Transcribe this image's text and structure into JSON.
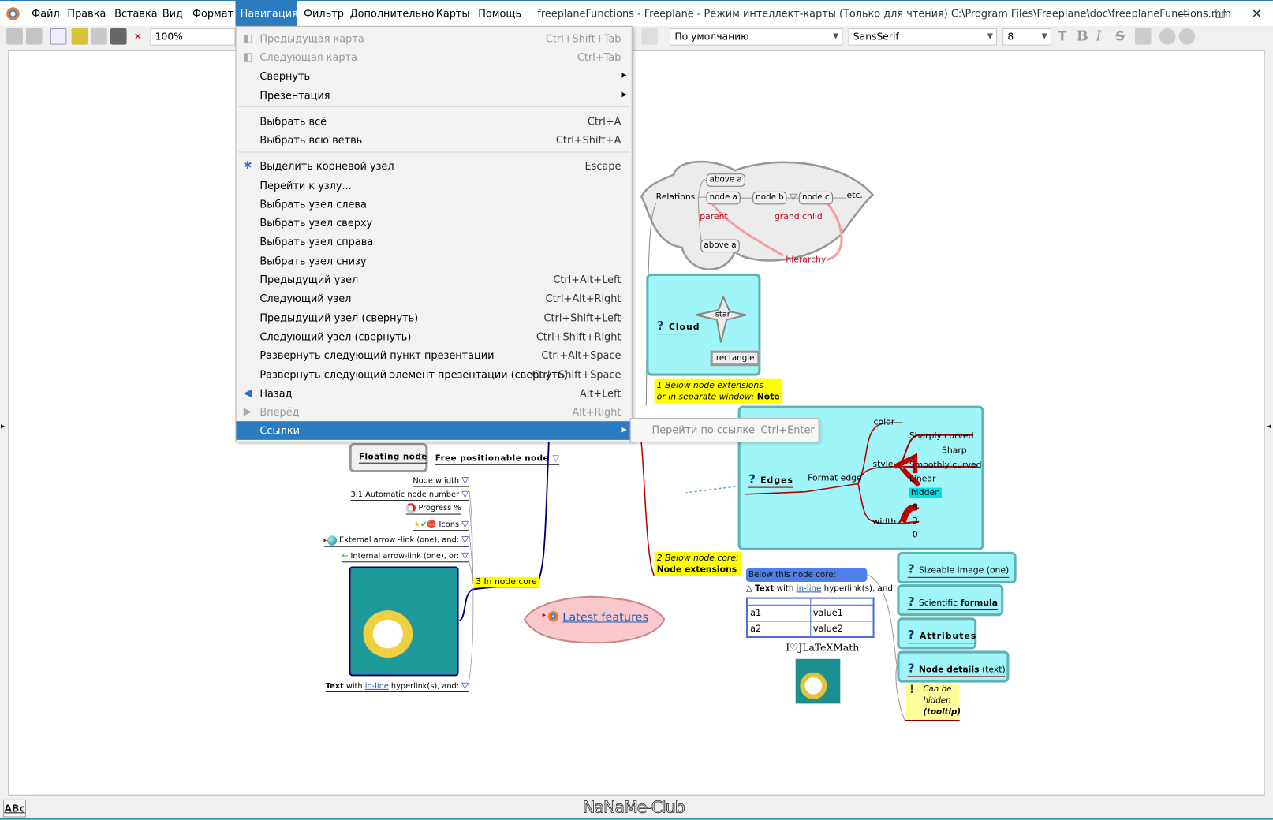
{
  "window": {
    "title": "freeplaneFunctions - Freeplane - Режим интеллект-карты (Только для чтения) C:\\Program Files\\Freeplane\\doc\\freeplaneFunctions.mm",
    "minimize": "—",
    "maximize": "☐",
    "close": "✕"
  },
  "menubar": {
    "items": [
      "Файл",
      "Правка",
      "Вставка",
      "Вид",
      "Формат",
      "Навигация",
      "Фильтр",
      "Дополнительно",
      "Карты",
      "Помощь"
    ],
    "active": "Навигация"
  },
  "toolbar": {
    "zoom": "100%",
    "style": "По умолчанию",
    "font": "SansSerif",
    "size": "8",
    "bold": "B",
    "italic": "I",
    "strike": "S"
  },
  "nav_menu": {
    "items": [
      {
        "label": "Предыдущая карта",
        "shortcut": "Ctrl+Shift+Tab",
        "disabled": true,
        "icon": "prev-map-icon"
      },
      {
        "label": "Следующая карта",
        "shortcut": "Ctrl+Tab",
        "disabled": true,
        "icon": "next-map-icon"
      },
      {
        "label": "Свернуть",
        "shortcut": "",
        "submenu": true
      },
      {
        "label": "Презентация",
        "shortcut": "",
        "submenu": true
      },
      {
        "label": "Выбрать всё",
        "shortcut": "Ctrl+A"
      },
      {
        "label": "Выбрать всю ветвь",
        "shortcut": "Ctrl+Shift+A"
      },
      {
        "label": "Выделить корневой узел",
        "shortcut": "Escape",
        "icon": "root-node-icon"
      },
      {
        "label": "Перейти к узлу...",
        "shortcut": ""
      },
      {
        "label": "Выбрать узел слева",
        "shortcut": ""
      },
      {
        "label": "Выбрать узел сверху",
        "shortcut": ""
      },
      {
        "label": "Выбрать узел справа",
        "shortcut": ""
      },
      {
        "label": "Выбрать узел снизу",
        "shortcut": ""
      },
      {
        "label": "Предыдущий узел",
        "shortcut": "Ctrl+Alt+Left"
      },
      {
        "label": "Следующий узел",
        "shortcut": "Ctrl+Alt+Right"
      },
      {
        "label": "Предыдущий узел (свернуть)",
        "shortcut": "Ctrl+Shift+Left"
      },
      {
        "label": "Следующий узел (свернуть)",
        "shortcut": "Ctrl+Shift+Right"
      },
      {
        "label": "Развернуть следующий пункт презентации",
        "shortcut": "Ctrl+Alt+Space"
      },
      {
        "label": "Развернуть следующий элемент презентации (свернуть)",
        "shortcut": "Ctrl+Shift+Space"
      },
      {
        "label": "Назад",
        "shortcut": "Alt+Left",
        "icon": "back-icon"
      },
      {
        "label": "Вперёд",
        "shortcut": "Alt+Right",
        "disabled": true,
        "icon": "forward-icon"
      },
      {
        "label": "Ссылки",
        "shortcut": "",
        "submenu": true,
        "highlighted": true
      }
    ]
  },
  "submenu": {
    "label": "Перейти по ссылке",
    "shortcut": "Ctrl+Enter"
  },
  "map": {
    "relations": {
      "root": "Relations",
      "above": "above a",
      "node_a": "node a",
      "node_b": "node b",
      "node_c": "node c",
      "etc": "etc.",
      "parent": "parent",
      "grand_child": "grand child",
      "hierarchy": "hierarchy"
    },
    "cloud": {
      "label": "Cloud",
      "star": "star",
      "rectangle": "rectangle"
    },
    "note1": {
      "line1": "1 Below node extensions",
      "line2": "or in separate window: ",
      "bold": "Note"
    },
    "edges": {
      "label": "Edges",
      "format": "Format edge",
      "color": "color",
      "style": "style",
      "width": "width",
      "styles": [
        "Sharply curved",
        "Sharp",
        "Smoothly curved",
        "Linear",
        "hidden"
      ],
      "widths": [
        "8",
        "3",
        "0"
      ]
    },
    "note2": {
      "line1": "2 Below node core:",
      "line2": "Node extensions"
    },
    "details": {
      "header": "Below  this  node core:",
      "text_bold": "Text",
      "text_pre": " with ",
      "link": "in-line",
      "text_post": " hyperlink(s), and:",
      "table": [
        [
          "",
          ""
        ],
        [
          "a1",
          "value1"
        ],
        [
          "a2",
          "value2"
        ]
      ],
      "latex": "I♡JLaTeXMath"
    },
    "right_nodes": [
      {
        "pre": "Sizeable image",
        "post": " (one)"
      },
      {
        "pre": "Scientific ",
        "post": "formula"
      },
      {
        "pre": "Attributes",
        "post": ""
      },
      {
        "pre": "Node details",
        "post": " (text)"
      }
    ],
    "tooltip": {
      "l1": "Can be",
      "l2": "hidden",
      "l3": "(tooltip)"
    },
    "root_node": "Latest features",
    "left": {
      "floating": "Floating node",
      "free": "Free positionable node",
      "node_width": "Node w idth",
      "auto_number": "3.1 Automatic node number",
      "progress": "Progress  %",
      "icons": "Icons",
      "external": "External arrow -link (one), and:",
      "internal": "Internal arrow-link (one), or:",
      "text_bold": "Text",
      "text_pre": "  with ",
      "link": "in-line",
      "text_post": " hyperlink(s), and:",
      "in_core": "3 In node core"
    }
  },
  "status": {
    "spell": "ABc",
    "watermark": "NaNaMe-Club"
  },
  "colors": {
    "accent": "#2b7bc0",
    "cyan_node": "#9ff5f7",
    "note": "#ffff00",
    "edge_red": "#c00000",
    "header_blue": "#4f7fe8"
  }
}
